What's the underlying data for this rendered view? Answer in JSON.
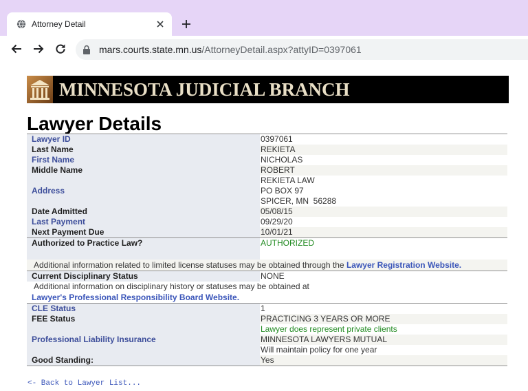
{
  "browser": {
    "tab_title": "Attorney Detail",
    "url_host": "mars.courts.state.mn.us",
    "url_path": "/AttorneyDetail.aspx?attyID=0397061"
  },
  "icons": {
    "tab_favicon": "globe-icon",
    "tab_close": "close-icon",
    "new_tab": "plus-icon",
    "back": "arrow-left-icon",
    "forward": "arrow-right-icon",
    "reload": "reload-icon",
    "security": "lock-icon"
  },
  "colors": {
    "tab_bar": "#e6d5f7",
    "label_bg": "#e8ebf1",
    "alt_row_bg": "#f4f4f0",
    "label_blue": "#3c4d9a",
    "label_dark": "#1e1e1e",
    "value_text": "#333333",
    "status_green": "#228b22",
    "link_blue": "#3a55b9",
    "rule_gray": "#8e8e8e",
    "banner_bg": "#000000",
    "banner_text": "#e9dfc6"
  },
  "banner": {
    "title": "MINNESOTA JUDICIAL BRANCH"
  },
  "page": {
    "heading": "Lawyer Details",
    "back_link": "<- Back to Lawyer List..."
  },
  "identity": [
    {
      "label": "Lawyer ID",
      "value": "0397061"
    },
    {
      "label": "Last Name",
      "value": "REKIETA"
    },
    {
      "label": "First Name",
      "value": "NICHOLAS"
    },
    {
      "label": "Middle Name",
      "value": "ROBERT"
    },
    {
      "label": "Address",
      "lines": [
        "REKIETA LAW",
        "PO BOX 97",
        "SPICER, MN  56288"
      ]
    },
    {
      "label": "Date Admitted",
      "value": "05/08/15"
    },
    {
      "label": "Last Payment",
      "value": "09/29/20"
    },
    {
      "label": "Next Payment Due",
      "value": "10/01/21"
    }
  ],
  "license": {
    "label": "Authorized to Practice Law?",
    "value": "AUTHORIZED",
    "note": "Additional information related to limited license statuses may be obtained through the ",
    "link": "Lawyer Registration Website."
  },
  "discipline": {
    "label": "Current Disciplinary Status",
    "value": "NONE",
    "note": "Additional information on disciplinary history or statuses may be obtained at",
    "link": "Lawyer's Professional Responsibility Board Website."
  },
  "status": [
    {
      "label": "CLE Status",
      "value": "1"
    },
    {
      "label": "FEE Status",
      "value": "PRACTICING 3 YEARS OR MORE"
    },
    {
      "value": "Lawyer does represent private clients"
    },
    {
      "label": "Professional Liability Insurance",
      "value": "MINNESOTA LAWYERS MUTUAL"
    },
    {
      "value": "Will maintain policy for one year"
    },
    {
      "label": "Good Standing:",
      "value": "Yes"
    }
  ]
}
